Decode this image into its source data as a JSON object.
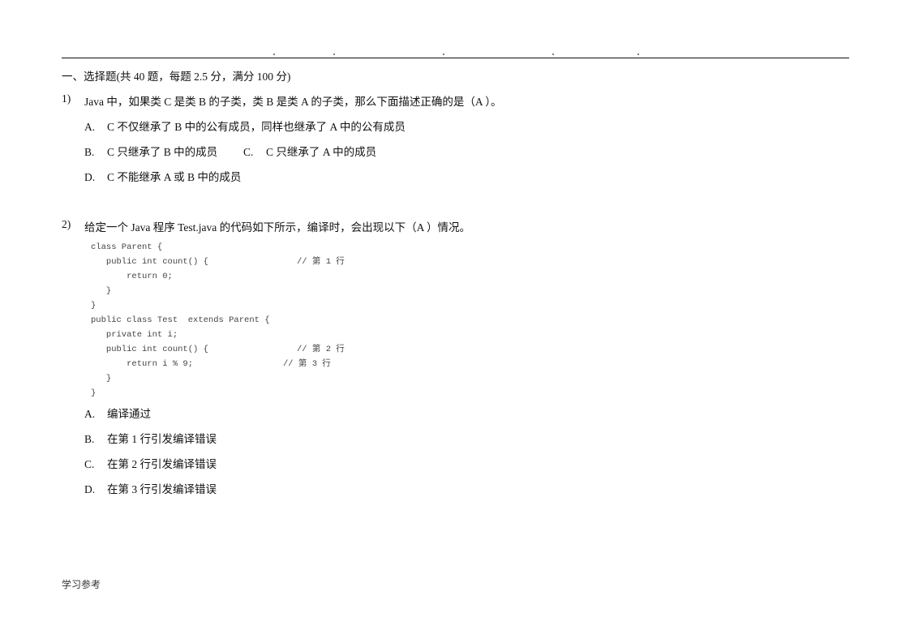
{
  "section_title": "一、选择题(共 40 题，每题 2.5 分，满分 100 分)",
  "questions": [
    {
      "number": "1)",
      "text": "Java 中，如果类 C 是类 B 的子类，类 B 是类 A 的子类，那么下面描述正确的是（A ）。",
      "options": [
        {
          "letter": "A.",
          "text": "C 不仅继承了 B 中的公有成员，同样也继承了 A 中的公有成员"
        },
        {
          "letter": "B.",
          "text": "C 只继承了 B 中的成员"
        },
        {
          "letter": "C.",
          "text": "C 只继承了 A 中的成员"
        },
        {
          "letter": "D.",
          "text": "C 不能继承 A 或 B 中的成员"
        }
      ]
    },
    {
      "number": "2)",
      "text": "给定一个 Java 程序 Test.java 的代码如下所示，编译时，会出现以下（A ）情况。",
      "code": [
        {
          "code": "class Parent {",
          "comment": ""
        },
        {
          "code": "   public int count() {",
          "comment": "// 第 1 行"
        },
        {
          "code": "       return 0;",
          "comment": ""
        },
        {
          "code": "   }",
          "comment": ""
        },
        {
          "code": "}",
          "comment": ""
        },
        {
          "code": "public class Test  extends Parent {",
          "comment": ""
        },
        {
          "code": "   private int i;",
          "comment": ""
        },
        {
          "code": "   public int count() {",
          "comment": "// 第 2 行"
        },
        {
          "code": "       return i % 9;",
          "comment": "// 第 3 行"
        },
        {
          "code": "   }",
          "comment": ""
        },
        {
          "code": "}",
          "comment": ""
        }
      ],
      "options": [
        {
          "letter": "A.",
          "text": "编译通过"
        },
        {
          "letter": "B.",
          "text": "在第 1 行引发编译错误"
        },
        {
          "letter": "C.",
          "text": "在第 2 行引发编译错误"
        },
        {
          "letter": "D.",
          "text": "在第 3 行引发编译错误"
        }
      ]
    }
  ],
  "footer": "学习参考"
}
